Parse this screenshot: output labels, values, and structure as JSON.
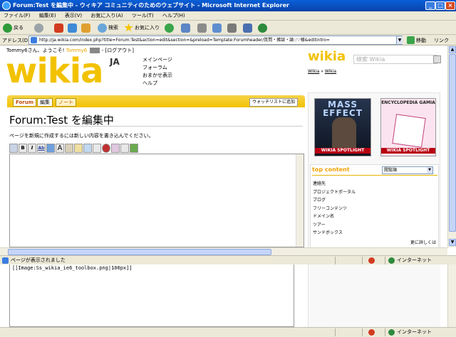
{
  "window": {
    "title": "Forum:Test を編集中 - ウィキア コミュニティのためのウェブサイト - Microsoft Internet Explorer",
    "minimize": "_",
    "maximize": "□",
    "close": "×"
  },
  "menu": [
    "ファイル(F)",
    "編集(E)",
    "表示(V)",
    "お気に入り(A)",
    "ツール(T)",
    "ヘルプ(H)"
  ],
  "toolbar": {
    "back": "戻る",
    "search": "検索",
    "favorites": "お気に入り"
  },
  "address": {
    "label": "アドレス(D)",
    "url": "http://ja.wikia.com/index.php?title=Forum:Test&action=edit&section=&preload=Template:Forumheader/質問・雑談・論::'-'様&editintro=",
    "go": "移動",
    "links": "リンク"
  },
  "page": {
    "userline_prefix": "Tommy6さん、ようこそ!",
    "username": "Tommy6",
    "logout": "- [ログアウト]",
    "logo": "wikia",
    "logo_lang": "JA",
    "nav": [
      "メインページ",
      "フォーラム",
      "おまかせ表示",
      "ヘルプ"
    ],
    "header_logo": "wikia",
    "search_placeholder": "検索 Wikia",
    "breadcrumb": [
      "Wikia",
      "Wikia"
    ],
    "breadcrumb_sep": "»",
    "tabs": {
      "forum": "Forum",
      "edit": "編集",
      "note": "ノート",
      "watch": "ウォッチリストに追加"
    },
    "title": "Forum:Test を編集中",
    "instructions": "ページを新規に作成するには新しい内容を書き込んでください。",
    "edit_buttons": [
      "B",
      "I",
      "Ab",
      "A"
    ]
  },
  "rail": {
    "spotlight1": {
      "heading": "MASS EFFECT",
      "label": "WIKIA SPOTLIGHT"
    },
    "spotlight2": {
      "heading": "ENCYCLOPEDIA GAMIA",
      "label": "WIKIA SPOTLIGHT"
    },
    "top_content": {
      "heading": "top content",
      "select_value": "閲覧順",
      "items": [
        "連絡先",
        "プロジェクトポータル",
        "ブログ",
        "フリーコンテンツ",
        "ドメイン名",
        "ツアー",
        "サンドボックス"
      ],
      "more": "更に詳しくは"
    }
  },
  "status": {
    "text": "ページが表示されました",
    "zone": "インターネット"
  },
  "lower": {
    "code": "[[Image:Ss_wikia_ie6_toolbox.png|100px]]",
    "zone": "インターネット"
  }
}
